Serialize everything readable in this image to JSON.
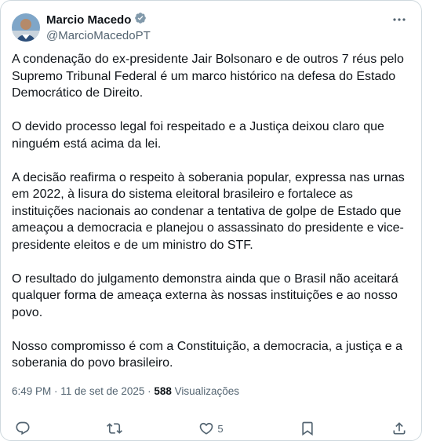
{
  "author": {
    "name": "Marcio Macedo",
    "handle": "@MarcioMacedoPT"
  },
  "post": {
    "paragraphs": [
      "A condenação do ex-presidente Jair Bolsonaro e de outros 7 réus pelo Supremo Tribunal Federal é um marco histórico na defesa do Estado Democrático de Direito.",
      "O devido processo legal foi respeitado e a Justiça deixou claro que ninguém está acima da lei.",
      "A decisão reafirma o respeito à soberania popular, expressa nas urnas em 2022, à lisura do sistema eleitoral brasileiro e fortalece as instituições nacionais ao condenar a tentativa de golpe de Estado que ameaçou a democracia e planejou o assassinato do presidente e vice-presidente eleitos e de um ministro do STF.",
      "O resultado do julgamento demonstra ainda que o Brasil não aceitará qualquer forma de ameaça externa às nossas instituições e ao nosso povo.",
      "Nosso compromisso é com a Constituição, a democracia, a justiça e a soberania do povo brasileiro."
    ]
  },
  "meta": {
    "time": "6:49 PM",
    "separator": " · ",
    "date": "11 de set de 2025",
    "views_count": "588",
    "views_label": "Visualizações"
  },
  "actions": {
    "likes_count": "5"
  },
  "icons": {
    "verified": "verified-badge-icon",
    "more": "more-options-icon",
    "reply": "reply-icon",
    "repost": "repost-icon",
    "like": "like-icon",
    "bookmark": "bookmark-icon",
    "share": "share-icon"
  },
  "colors": {
    "verified_badge": "#829aab",
    "secondary_text": "#536471",
    "primary_text": "#0f1419"
  }
}
